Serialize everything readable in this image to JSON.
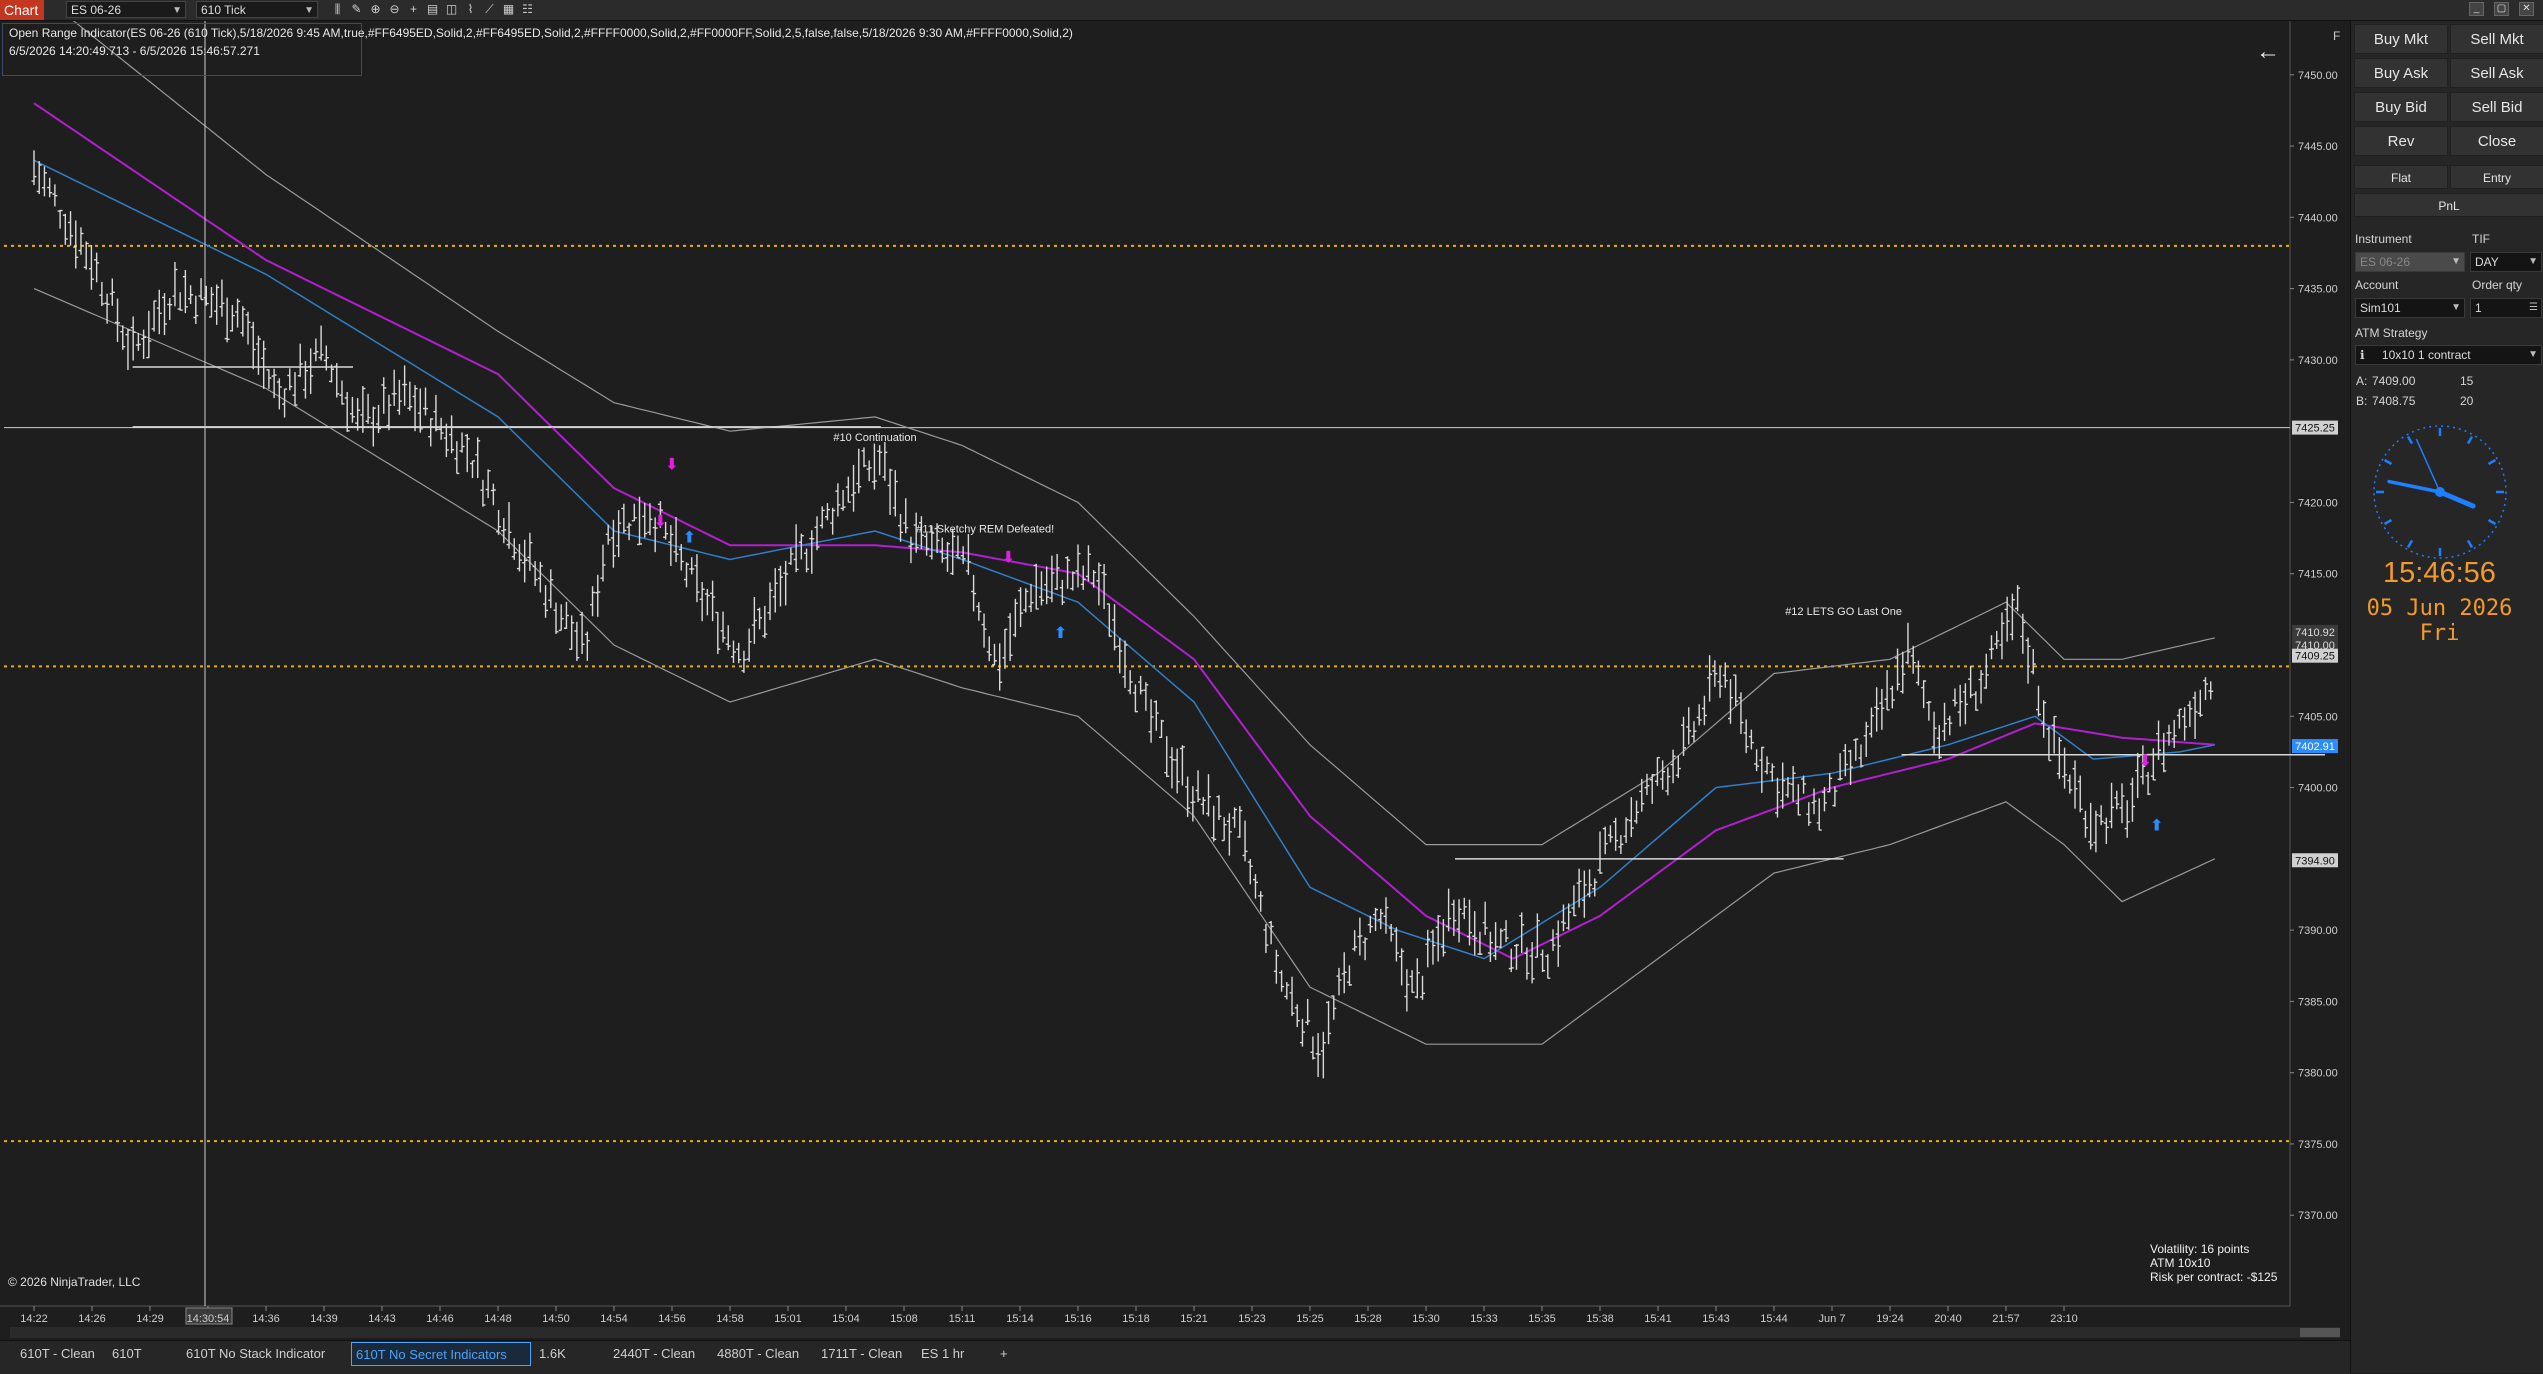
{
  "toolbar": {
    "chart_tab": "Chart",
    "instrument": "ES 06-26",
    "bar_type": "610 Tick",
    "tools": [
      "bars-icon",
      "pencil-icon",
      "zoom-in-icon",
      "zoom-out-icon",
      "crosshair-icon",
      "properties-icon",
      "templates-icon",
      "strategies-icon",
      "drawing-tools-icon",
      "chart-trader-icon",
      "layout-icon"
    ]
  },
  "indicator": {
    "line1": "Open Range Indicator(ES 06-26 (610 Tick),5/18/2026 9:45 AM,true,#FF6495ED,Solid,2,#FF6495ED,Solid,2,#FFFF0000,Solid,2,#FF0000FF,Solid,2,5,false,false,5/18/2026 9:30 AM,#FFFF0000,Solid,2)",
    "line2": "6/5/2026 14:20:49.713 - 6/5/2026 15:46:57.271"
  },
  "chart": {
    "copyright": "© 2026 NinjaTrader, LLC",
    "stats": [
      "Volatility: 16 points",
      "ATM 10x10",
      "Risk per contract: -$125"
    ],
    "annotations": [
      {
        "text": "#10 Continuation",
        "time_index": 14.5,
        "price": 7424.3
      },
      {
        "text": "#11 Sketchy REM Defeated!",
        "time_index": 16.4,
        "price": 7417.9
      },
      {
        "text": "#12 LETS GO Last One",
        "time_index": 31.2,
        "price": 7412.1
      }
    ],
    "price_ticks": [
      {
        "label": "7450.00",
        "value": 7450
      },
      {
        "label": "7445.00",
        "value": 7445
      },
      {
        "label": "7440.00",
        "value": 7440
      },
      {
        "label": "7435.00",
        "value": 7435
      },
      {
        "label": "7430.00",
        "value": 7430
      },
      {
        "label": "7420.00",
        "value": 7420
      },
      {
        "label": "7415.00",
        "value": 7415
      },
      {
        "label": "7405.00",
        "value": 7405
      },
      {
        "label": "7400.00",
        "value": 7400
      },
      {
        "label": "7390.00",
        "value": 7390
      },
      {
        "label": "7385.00",
        "value": 7385
      },
      {
        "label": "7380.00",
        "value": 7380
      },
      {
        "label": "7375.00",
        "value": 7375
      },
      {
        "label": "7370.00",
        "value": 7370
      }
    ],
    "price_markers": [
      {
        "label": "7425.25",
        "value": 7425.25,
        "color": "#d0d0d0",
        "text_color": "#111"
      },
      {
        "label": "7410.92",
        "value": 7410.92,
        "color": "#3a3a3a",
        "text_color": "#ddd"
      },
      {
        "label": "7410.00",
        "value": 7410.0,
        "color": "#3a3a3a",
        "text_color": "#ddd"
      },
      {
        "label": "7409.25",
        "value": 7409.25,
        "color": "#d0d0d0",
        "text_color": "#111"
      },
      {
        "label": "7402.91",
        "value": 7402.91,
        "color": "#2a8cff",
        "text_color": "#fff"
      },
      {
        "label": "7394.90",
        "value": 7394.9,
        "color": "#d0d0d0",
        "text_color": "#111"
      }
    ],
    "time_labels": [
      "14:22",
      "14:26",
      "14:29",
      "14:30:54",
      "14:36",
      "14:39",
      "14:43",
      "14:46",
      "14:48",
      "14:50",
      "14:54",
      "14:56",
      "14:58",
      "15:01",
      "15:04",
      "15:08",
      "15:11",
      "15:14",
      "15:16",
      "15:18",
      "15:21",
      "15:23",
      "15:25",
      "15:28",
      "15:30",
      "15:33",
      "15:35",
      "15:38",
      "15:41",
      "15:43",
      "15:44",
      "Jun 7",
      "19:24",
      "20:40",
      "21:57",
      "23:10"
    ],
    "crosshair_time_index": 3,
    "crosshair_label": "14:30:54",
    "level_lines": [
      {
        "value": 7438,
        "color": "#e6b400",
        "style": "dotted"
      },
      {
        "value": 7408.5,
        "color": "#e6b400",
        "style": "dotted"
      },
      {
        "value": 7375.2,
        "color": "#e6b400",
        "style": "dotted"
      },
      {
        "value": 7425.25,
        "color": "#cfcfcf",
        "style": "solid"
      }
    ],
    "colors": {
      "bars": "#d9d9d9",
      "ema_fast": "#2f7fc9",
      "ema_slow": "#b21fd0",
      "bands": "#9a9a9a",
      "arrow_down": "#e020e0",
      "arrow_up": "#2a8cff"
    }
  },
  "panel": {
    "order_buttons": [
      "Buy Mkt",
      "Sell Mkt",
      "Buy Ask",
      "Sell Ask",
      "Buy Bid",
      "Sell Bid",
      "Rev",
      "Close"
    ],
    "small_buttons": [
      "Flat",
      "Entry",
      "PnL"
    ],
    "instrument_label": "Instrument",
    "instrument_value": "ES 06-26",
    "tif_label": "TIF",
    "tif_value": "DAY",
    "account_label": "Account",
    "account_value": "Sim101",
    "order_qty_label": "Order qty",
    "order_qty_value": "1",
    "atm_label": "ATM Strategy",
    "atm_value": "10x10 1 contract",
    "ask_label": "A:",
    "ask_price": "7409.00",
    "ask_size": "15",
    "bid_label": "B:",
    "bid_price": "7408.75",
    "bid_size": "20"
  },
  "clock": {
    "time": "15:46:56",
    "date": "05 Jun 2026 Fri",
    "hour": 15,
    "minute": 46,
    "second": 56,
    "color": "#1e7fff"
  },
  "tabs": [
    {
      "label": "610T - Clean",
      "active": false
    },
    {
      "label": "610T",
      "active": false
    },
    {
      "label": "610T No Stack Indicator",
      "active": false
    },
    {
      "label": "610T No Secret Indicators",
      "active": true
    },
    {
      "label": "1.6K",
      "active": false
    },
    {
      "label": "2440T - Clean",
      "active": false
    },
    {
      "label": "4880T - Clean",
      "active": false
    },
    {
      "label": "1711T - Clean",
      "active": false
    },
    {
      "label": "ES 1 hr",
      "active": false
    },
    {
      "label": "+",
      "active": false
    }
  ],
  "chart_data": {
    "type": "candlestick",
    "ylim": [
      7367,
      7453
    ],
    "keypoints": [
      [
        0,
        7443.5
      ],
      [
        1,
        7437
      ],
      [
        1.7,
        7430.5
      ],
      [
        2.4,
        7435
      ],
      [
        3.5,
        7433.5
      ],
      [
        4.2,
        7427.5
      ],
      [
        5,
        7430.5
      ],
      [
        5.6,
        7425.5
      ],
      [
        6.4,
        7427.5
      ],
      [
        7.5,
        7423.5
      ],
      [
        8.5,
        7416
      ],
      [
        9.5,
        7409.5
      ],
      [
        9.9,
        7418
      ],
      [
        10.6,
        7419.5
      ],
      [
        11.5,
        7413.5
      ],
      [
        12.2,
        7409.5
      ],
      [
        13.1,
        7415.5
      ],
      [
        14.1,
        7421.5
      ],
      [
        14.6,
        7423
      ],
      [
        15.1,
        7417.5
      ],
      [
        16.1,
        7415.5
      ],
      [
        16.6,
        7408.5
      ],
      [
        17.2,
        7414
      ],
      [
        18.3,
        7415
      ],
      [
        19.2,
        7405
      ],
      [
        20,
        7399.5
      ],
      [
        20.8,
        7396.5
      ],
      [
        21.5,
        7386.5
      ],
      [
        22.2,
        7381.5
      ],
      [
        22.7,
        7388
      ],
      [
        23.2,
        7391
      ],
      [
        23.8,
        7385.5
      ],
      [
        24.5,
        7392
      ],
      [
        25.2,
        7389
      ],
      [
        26.1,
        7388.5
      ],
      [
        26.9,
        7394
      ],
      [
        27.6,
        7398.5
      ],
      [
        28.5,
        7403
      ],
      [
        29.1,
        7408.5
      ],
      [
        29.5,
        7404
      ],
      [
        30.1,
        7400
      ],
      [
        30.8,
        7398.5
      ],
      [
        31.6,
        7403
      ],
      [
        32.3,
        7409.5
      ],
      [
        32.8,
        7404
      ],
      [
        33.6,
        7407.5
      ],
      [
        34.2,
        7412.5
      ],
      [
        34.8,
        7403
      ],
      [
        35.5,
        7397.5
      ],
      [
        36.1,
        7398.5
      ],
      [
        36.6,
        7402.5
      ],
      [
        37.1,
        7405
      ],
      [
        37.6,
        7408
      ]
    ],
    "ema_fast": [
      [
        0,
        7444
      ],
      [
        4,
        7436
      ],
      [
        8,
        7426
      ],
      [
        10,
        7418
      ],
      [
        12,
        7416
      ],
      [
        14.5,
        7418
      ],
      [
        16,
        7416
      ],
      [
        18,
        7413
      ],
      [
        20,
        7406
      ],
      [
        22,
        7393
      ],
      [
        23.5,
        7390
      ],
      [
        25,
        7388
      ],
      [
        27,
        7393
      ],
      [
        29,
        7400
      ],
      [
        31,
        7401
      ],
      [
        33,
        7403
      ],
      [
        34.5,
        7405
      ],
      [
        35.5,
        7402
      ],
      [
        37,
        7402.5
      ],
      [
        37.6,
        7403
      ]
    ],
    "ema_slow": [
      [
        0,
        7448
      ],
      [
        4,
        7437
      ],
      [
        8,
        7429
      ],
      [
        10,
        7421
      ],
      [
        12,
        7417
      ],
      [
        14.5,
        7417
      ],
      [
        16,
        7416.5
      ],
      [
        18,
        7415
      ],
      [
        20,
        7409
      ],
      [
        22,
        7398
      ],
      [
        24,
        7391
      ],
      [
        25.5,
        7388
      ],
      [
        27,
        7391
      ],
      [
        29,
        7397
      ],
      [
        31,
        7400
      ],
      [
        33,
        7402
      ],
      [
        34.5,
        7404.5
      ],
      [
        36,
        7403.5
      ],
      [
        37.6,
        7403
      ]
    ],
    "band_upper": [
      [
        0,
        7456
      ],
      [
        4,
        7443
      ],
      [
        8,
        7432
      ],
      [
        10,
        7427
      ],
      [
        12,
        7425
      ],
      [
        14.5,
        7426
      ],
      [
        16,
        7424
      ],
      [
        18,
        7420
      ],
      [
        20,
        7412
      ],
      [
        22,
        7403
      ],
      [
        24,
        7396
      ],
      [
        26,
        7396
      ],
      [
        28,
        7401
      ],
      [
        30,
        7408
      ],
      [
        32,
        7409
      ],
      [
        34,
        7413
      ],
      [
        35,
        7409
      ],
      [
        36,
        7409
      ],
      [
        37.6,
        7410.5
      ]
    ],
    "band_lower": [
      [
        0,
        7435
      ],
      [
        4,
        7428
      ],
      [
        8,
        7418
      ],
      [
        10,
        7410
      ],
      [
        12,
        7406
      ],
      [
        14.5,
        7409
      ],
      [
        16,
        7407
      ],
      [
        18,
        7405
      ],
      [
        20,
        7398
      ],
      [
        22,
        7386
      ],
      [
        24,
        7382
      ],
      [
        26,
        7382
      ],
      [
        28,
        7388
      ],
      [
        30,
        7394
      ],
      [
        32,
        7396
      ],
      [
        34,
        7399
      ],
      [
        35,
        7396
      ],
      [
        36,
        7392
      ],
      [
        37.6,
        7395
      ]
    ],
    "h_segments": [
      {
        "x1": 1.7,
        "x2": 5.5,
        "value": 7429.5
      },
      {
        "x1": 1.7,
        "x2": 14.6,
        "value": 7425.3
      },
      {
        "x1": 24.5,
        "x2": 31.2,
        "value": 7395
      },
      {
        "x1": 32.2,
        "x2": 39.5,
        "value": 7402.3
      }
    ],
    "arrows": [
      {
        "x": 11.0,
        "value": 7422.3,
        "dir": "down"
      },
      {
        "x": 10.8,
        "value": 7418.3,
        "dir": "down"
      },
      {
        "x": 11.3,
        "value": 7417.2,
        "dir": "up"
      },
      {
        "x": 16.8,
        "value": 7415.8,
        "dir": "down"
      },
      {
        "x": 17.7,
        "value": 7410.5,
        "dir": "up"
      },
      {
        "x": 36.4,
        "value": 7401.5,
        "dir": "down"
      },
      {
        "x": 36.6,
        "value": 7397.0,
        "dir": "up"
      }
    ]
  }
}
